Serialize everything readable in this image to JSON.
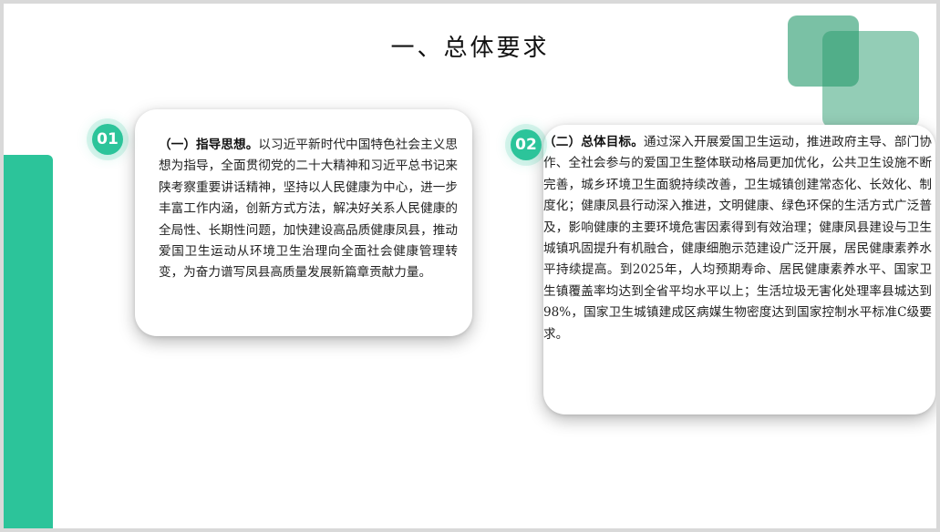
{
  "slide": {
    "title": "一、总体要求",
    "colors": {
      "accent": "#2cc49a",
      "deco": "#2b9b6e"
    },
    "cards": [
      {
        "badge": "01",
        "lead": "（一）指导思想。",
        "body": "以习近平新时代中国特色社会主义思想为指导，全面贯彻党的二十大精神和习近平总书记来陕考察重要讲话精神，坚持以人民健康为中心，进一步丰富工作内涵，创新方式方法，解决好关系人民健康的全局性、长期性问题，加快建设高品质健康凤县，推动爱国卫生运动从环境卫生治理向全面社会健康管理转变，为奋力谱写凤县高质量发展新篇章贡献力量。"
      },
      {
        "badge": "02",
        "lead": "（二）总体目标。",
        "body": "通过深入开展爱国卫生运动，推进政府主导、部门协作、全社会参与的爱国卫生整体联动格局更加优化，公共卫生设施不断完善，城乡环境卫生面貌持续改善，卫生城镇创建常态化、长效化、制度化；健康凤县行动深入推进，文明健康、绿色环保的生活方式广泛普及，影响健康的主要环境危害因素得到有效治理；健康凤县建设与卫生城镇巩固提升有机融合，健康细胞示范建设广泛开展，居民健康素养水平持续提高。到2025年，人均预期寿命、居民健康素养水平、国家卫生镇覆盖率均达到全省平均水平以上；生活垃圾无害化处理率县城达到98%，国家卫生城镇建成区病媒生物密度达到国家控制水平标准C级要求。"
      }
    ]
  }
}
